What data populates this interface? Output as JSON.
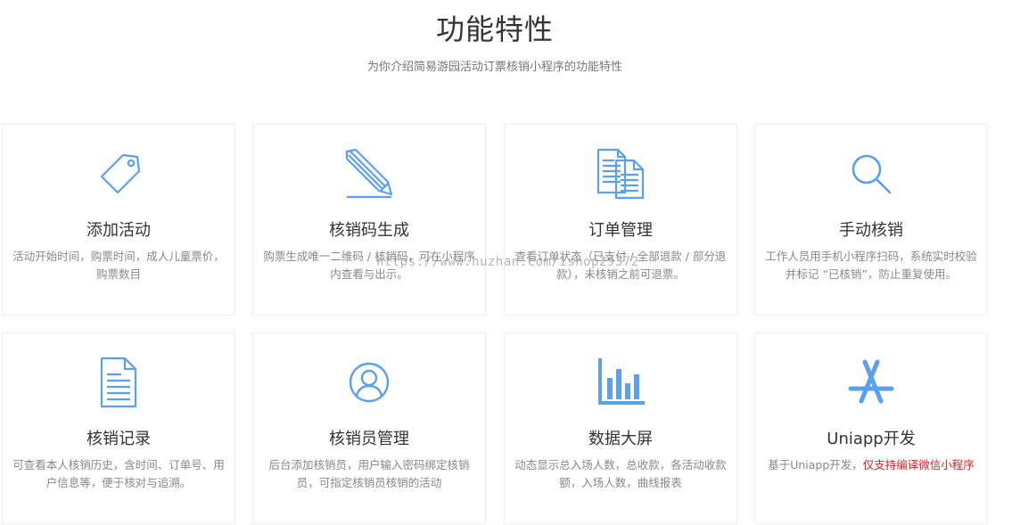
{
  "header": {
    "title": "功能特性",
    "subtitle": "为你介绍简易游园活动订票核销小程序的功能特性"
  },
  "colors": {
    "icon": "#5b9ff0",
    "highlight": "#e02020"
  },
  "features": [
    {
      "title": "添加活动",
      "desc": "活动开始时间，购票时间，成人儿童票价，购票数目",
      "icon": "tag-icon"
    },
    {
      "title": "核销码生成",
      "desc": "购票生成唯一二维码 / 核销码，可在小程序内查看与出示。",
      "icon": "pencil-icon"
    },
    {
      "title": "订单管理",
      "desc": "查看订单状态（已支付 / 全部退款 / 部分退款），未核销之前可退票。",
      "icon": "documents-icon"
    },
    {
      "title": "手动核销",
      "desc": "工作人员用手机小程序扫码，系统实时校验并标记 “已核销”，防止重复使用。",
      "icon": "search-icon"
    },
    {
      "title": "核销记录",
      "desc": "可查看本人核销历史，含时间、订单号、用户信息等，便于核对与追溯。",
      "icon": "document-icon"
    },
    {
      "title": "核销员管理",
      "desc": "后台添加核销员，用户输入密码绑定核销员，可指定核销员核销的活动",
      "icon": "user-icon"
    },
    {
      "title": "数据大屏",
      "desc": "动态显示总入场人数，总收款，各活动收款额，入场人数，曲线报表",
      "icon": "bar-chart-icon"
    },
    {
      "title": "Uniapp开发",
      "desc": "基于Uniapp开发，",
      "desc_highlight": "仅支持编译微信小程序",
      "icon": "app-store-icon"
    }
  ],
  "watermark": "https://www.huzhan.com/ishop29372"
}
